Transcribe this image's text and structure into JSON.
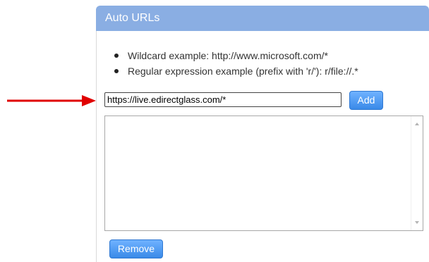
{
  "panel": {
    "title": "Auto URLs"
  },
  "examples": [
    "Wildcard example: http://www.microsoft.com/*",
    "Regular expression example (prefix with 'r/'): r/file://.*"
  ],
  "url_input": {
    "value": "https://live.edirectglass.com/*"
  },
  "buttons": {
    "add_label": "Add",
    "remove_label": "Remove"
  },
  "url_list": {
    "items": []
  },
  "colors": {
    "header_bg": "#8aaee3",
    "button_blue": "#3a8ae8",
    "arrow_red": "#e00000"
  },
  "icons": {
    "pointer": "red-arrow-icon",
    "scroll_up": "scroll-up-icon",
    "scroll_down": "scroll-down-icon"
  }
}
